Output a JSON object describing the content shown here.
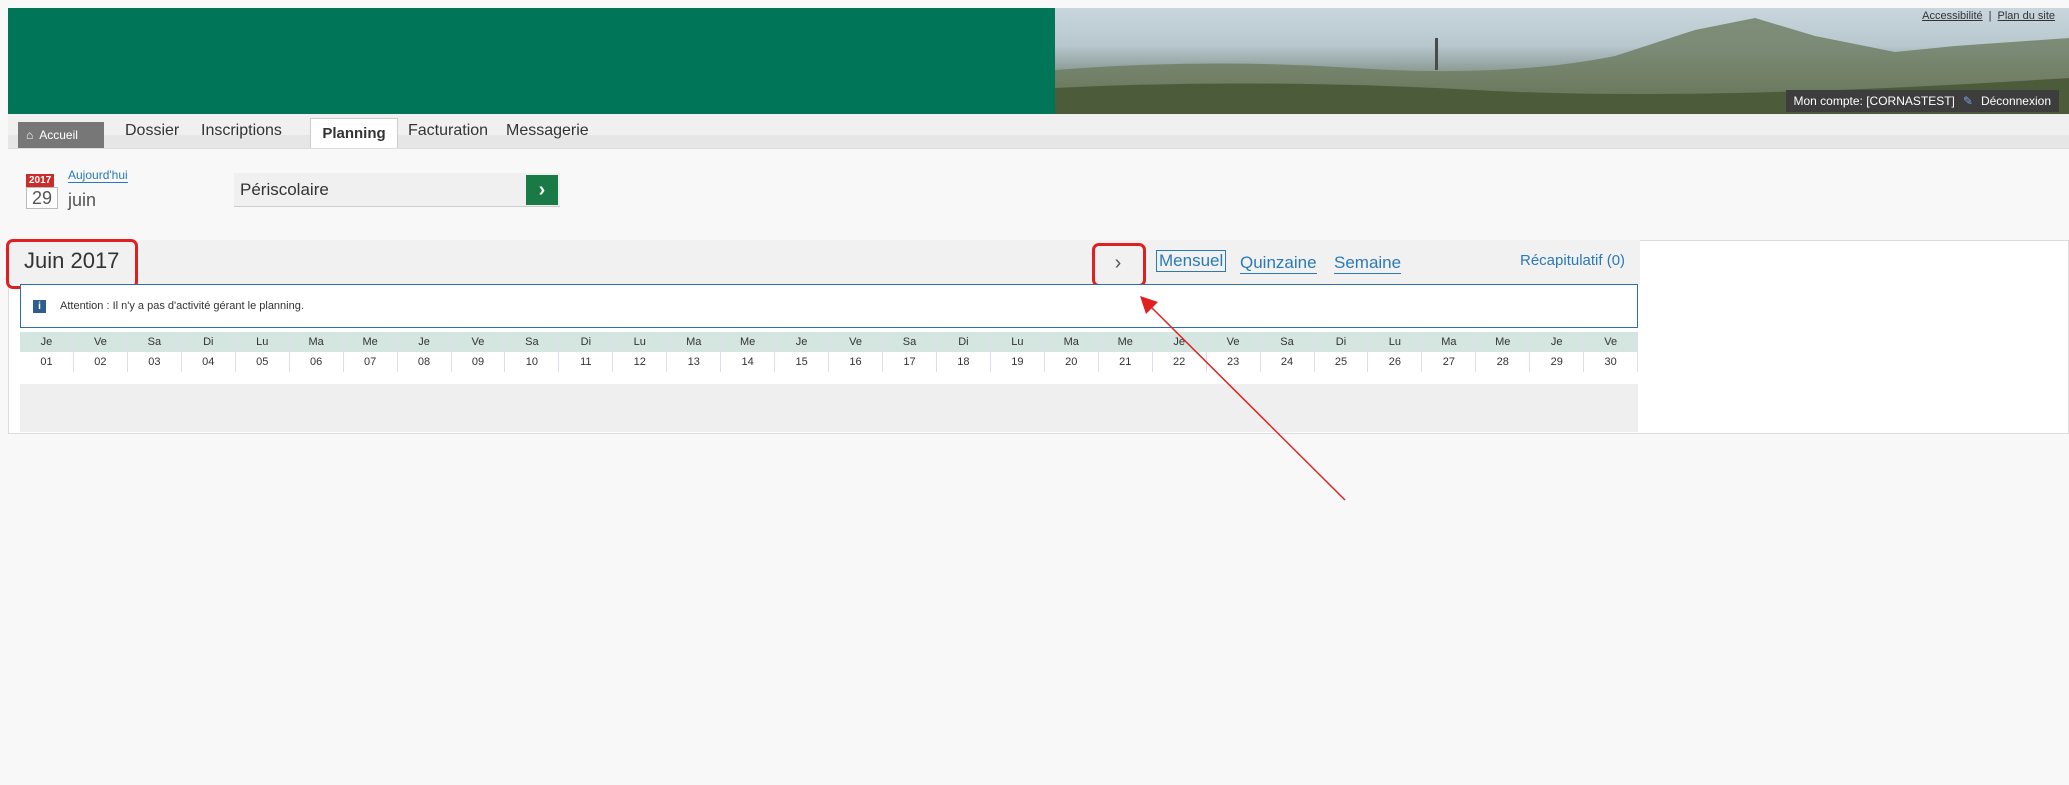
{
  "header": {
    "links": [
      "Accessibilité",
      "Plan du site"
    ],
    "account": "Mon compte: [CORNASTEST]",
    "logout": "Déconnexion"
  },
  "nav": {
    "home": "Accueil",
    "items": [
      "Dossier",
      "Inscriptions",
      "Planning",
      "Facturation",
      "Messagerie"
    ],
    "active": "Planning"
  },
  "today": {
    "year": "2017",
    "day": "29",
    "month": "juin",
    "link": "Aujourd'hui"
  },
  "service": {
    "selected": "Périscolaire"
  },
  "calendar": {
    "title": "Juin 2017",
    "views": [
      "Mensuel",
      "Quinzaine",
      "Semaine"
    ],
    "active_view": "Mensuel",
    "recap": "Récapitulatif (0)",
    "alert": "Attention : Il n'y a pas d'activité gérant le planning.",
    "day_names": [
      "Je",
      "Ve",
      "Sa",
      "Di",
      "Lu",
      "Ma",
      "Me",
      "Je",
      "Ve",
      "Sa",
      "Di",
      "Lu",
      "Ma",
      "Me",
      "Je",
      "Ve",
      "Sa",
      "Di",
      "Lu",
      "Ma",
      "Me",
      "Je",
      "Ve",
      "Sa",
      "Di",
      "Lu",
      "Ma",
      "Me",
      "Je",
      "Ve"
    ],
    "days": [
      "01",
      "02",
      "03",
      "04",
      "05",
      "06",
      "07",
      "08",
      "09",
      "10",
      "11",
      "12",
      "13",
      "14",
      "15",
      "16",
      "17",
      "18",
      "19",
      "20",
      "21",
      "22",
      "23",
      "24",
      "25",
      "26",
      "27",
      "28",
      "29",
      "30"
    ]
  },
  "colors": {
    "banner_green": "#007558",
    "link_blue": "#2a7ab5",
    "highlight_red": "#e02020",
    "go_button": "#1a7a45"
  }
}
